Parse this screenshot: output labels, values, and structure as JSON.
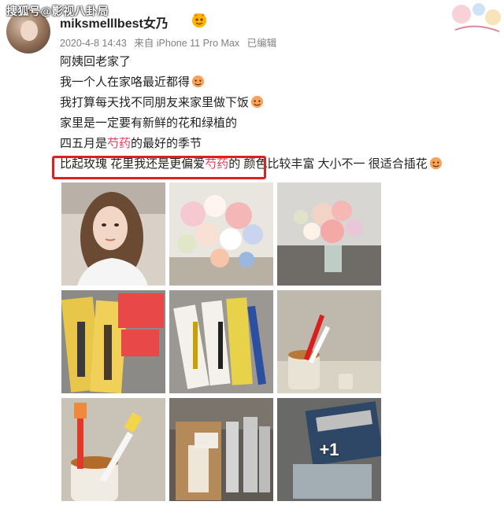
{
  "watermark": "搜狐号@影视八卦局",
  "post": {
    "username": "miksmelllbest女乃",
    "timestamp": "2020-4-8 14:43",
    "source": "来自 iPhone 11 Pro Max",
    "edited": "已编辑",
    "lines": [
      "阿姨回老家了",
      "我一个人在家咯最近都得",
      "我打算每天找不同朋友来家里做下饭",
      "家里是一定要有新鲜的花和绿植的",
      {
        "before": "四五月是",
        "highlight": "芍药",
        "after": "的最好的季节"
      },
      {
        "before": "比起玫瑰 花里我还是更偏爱",
        "highlight": "芍药",
        "after": "的 颜色比较丰富 大小不一 很适合插花"
      }
    ],
    "more_count": "+1"
  },
  "colors": {
    "highlight": "#e8395a",
    "box": "#e02020",
    "meta": "#808080"
  },
  "photos": [
    "woman-portrait",
    "flower-arrangement",
    "flower-vase",
    "toothbrush-packages",
    "toothbrushes-on-floor",
    "toothbrush-in-cup",
    "toothbrushes-in-mug",
    "bottles-on-shelf",
    "product-boxes"
  ]
}
